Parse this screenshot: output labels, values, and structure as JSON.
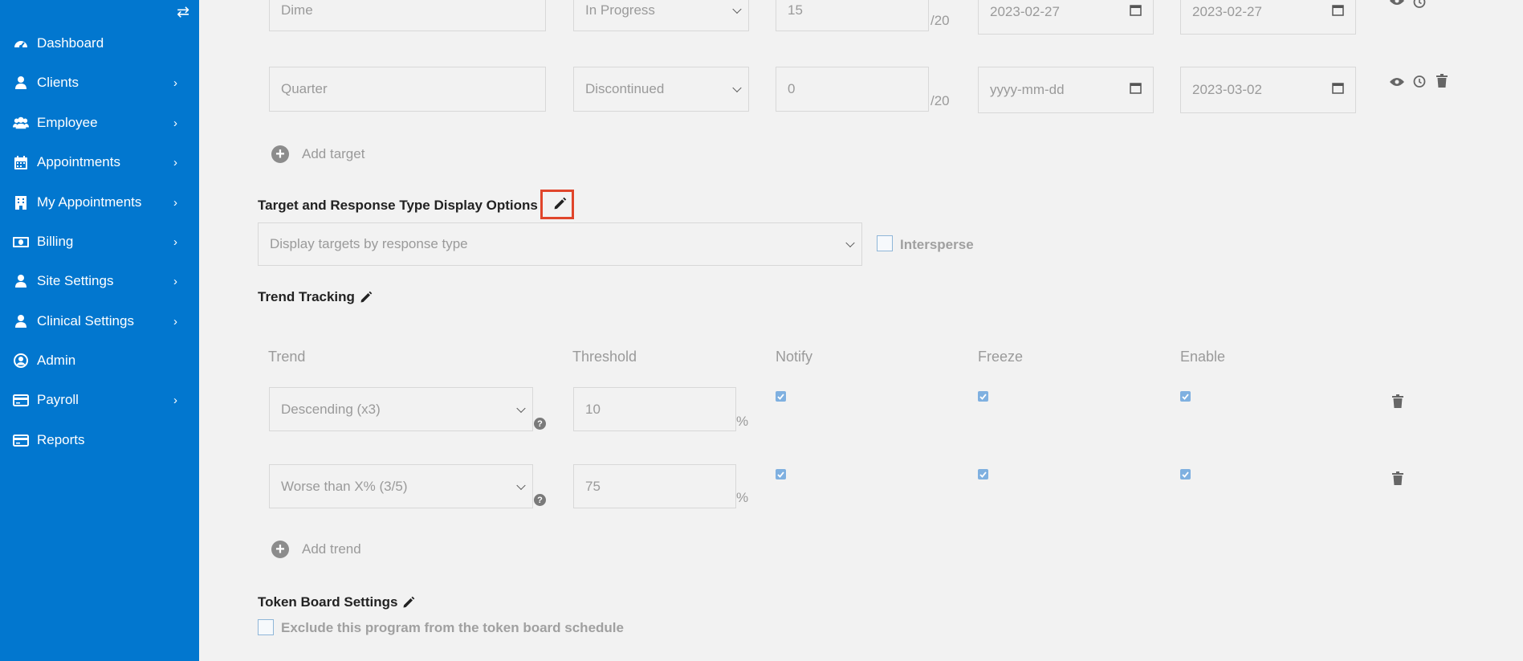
{
  "sidebar": {
    "toggle_icon": "swap-arrows-icon",
    "items": [
      {
        "label": "Dashboard",
        "icon": "tachometer-icon",
        "has_children": false
      },
      {
        "label": "Clients",
        "icon": "user-icon",
        "has_children": true
      },
      {
        "label": "Employee",
        "icon": "users-icon",
        "has_children": true
      },
      {
        "label": "Appointments",
        "icon": "calendar-icon",
        "has_children": true
      },
      {
        "label": "My Appointments",
        "icon": "building-icon",
        "has_children": true
      },
      {
        "label": "Billing",
        "icon": "money-icon",
        "has_children": true
      },
      {
        "label": "Site Settings",
        "icon": "user-icon",
        "has_children": true
      },
      {
        "label": "Clinical Settings",
        "icon": "user-icon",
        "has_children": true
      },
      {
        "label": "Admin",
        "icon": "user-circle-icon",
        "has_children": false
      },
      {
        "label": "Payroll",
        "icon": "credit-card-icon",
        "has_children": true
      },
      {
        "label": "Reports",
        "icon": "credit-card-icon",
        "has_children": false
      }
    ]
  },
  "targets": {
    "rows": [
      {
        "name": "Dime",
        "status": "In Progress",
        "score": "15",
        "out_of": "/20",
        "start_date": "2023-02-27",
        "end_date": "2023-02-27"
      },
      {
        "name": "Quarter",
        "status": "Discontinued",
        "score": "0",
        "out_of": "/20",
        "start_date_placeholder": "yyyy-mm-dd",
        "end_date": "2023-03-02"
      }
    ],
    "add_label": "Add target"
  },
  "display_options": {
    "title": "Target and Response Type Display Options",
    "select_value": "Display targets by response type",
    "intersperse_label": "Intersperse"
  },
  "trend_tracking": {
    "title": "Trend Tracking",
    "headers": {
      "trend": "Trend",
      "threshold": "Threshold",
      "notify": "Notify",
      "freeze": "Freeze",
      "enable": "Enable"
    },
    "rows": [
      {
        "trend": "Descending (x3)",
        "threshold": "10",
        "unit": "%",
        "notify": true,
        "freeze": true,
        "enable": true
      },
      {
        "trend": "Worse than X% (3/5)",
        "threshold": "75",
        "unit": "%",
        "notify": true,
        "freeze": true,
        "enable": true
      }
    ],
    "add_label": "Add trend"
  },
  "token_board": {
    "title": "Token Board Settings",
    "exclude_label": "Exclude this program from the token board schedule"
  },
  "colors": {
    "sidebar": "#0277cf",
    "highlight": "#e0452b",
    "checkbox": "#7fb0e0"
  }
}
